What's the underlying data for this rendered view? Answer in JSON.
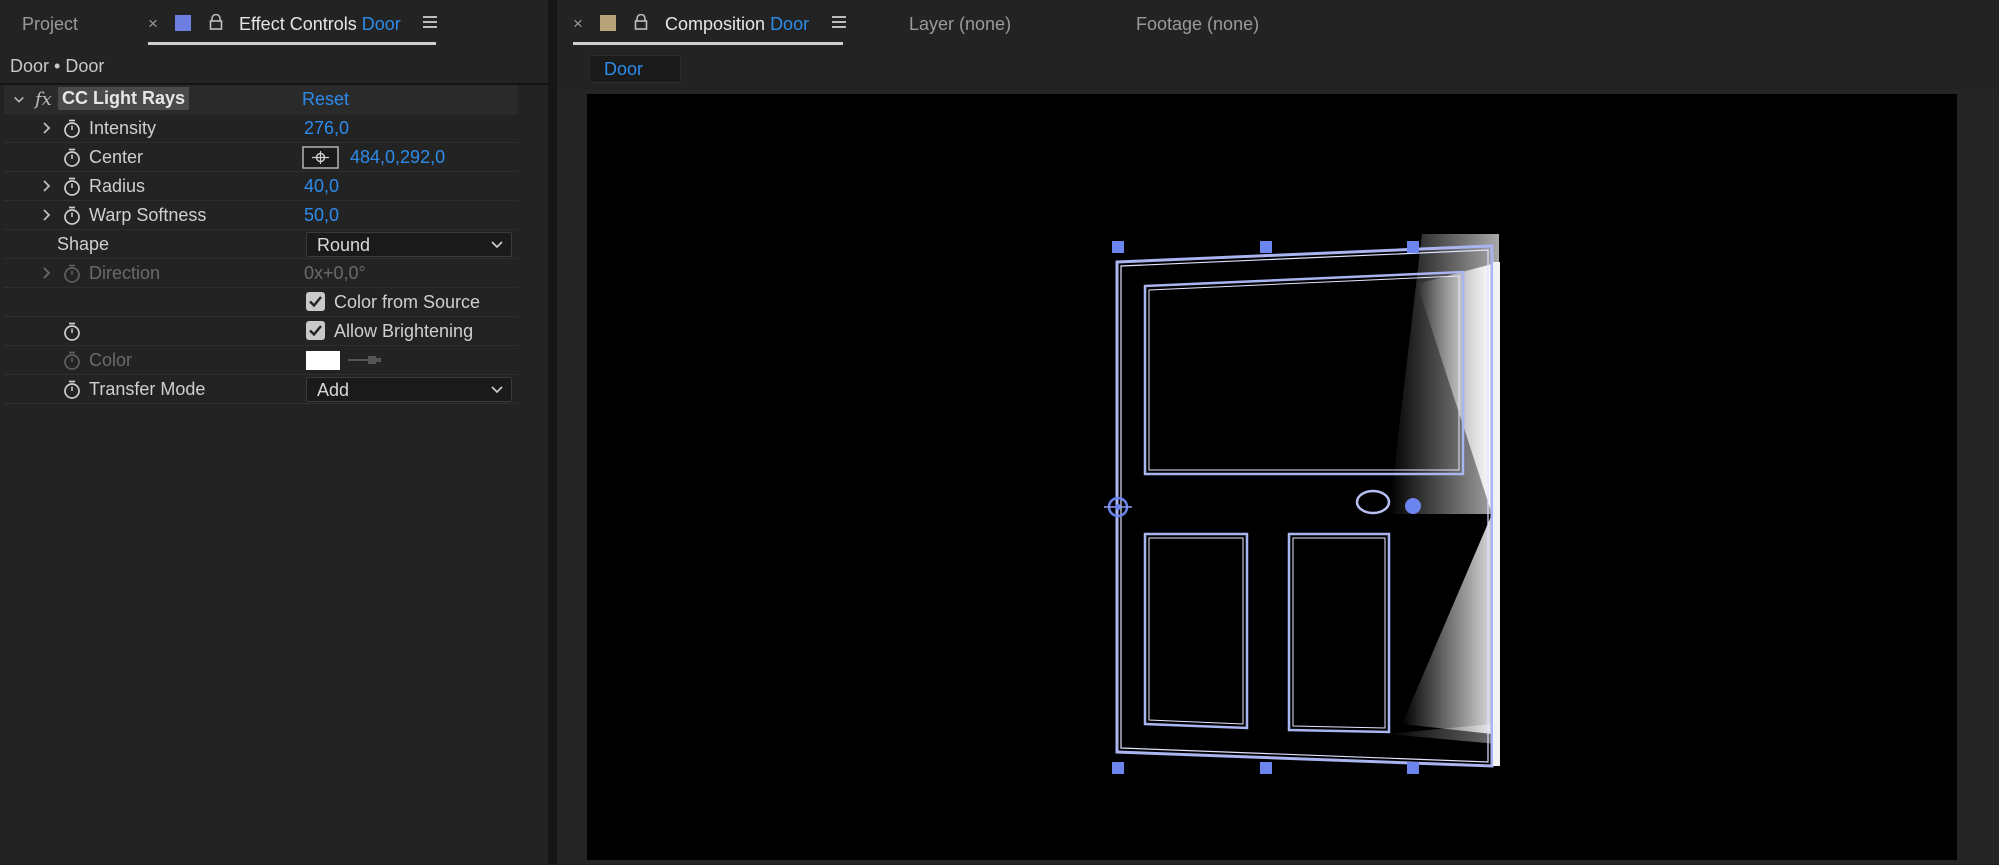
{
  "left_panel": {
    "tabs": {
      "project": "Project",
      "effect_controls_title": "Effect Controls",
      "effect_controls_layer": "Door",
      "close_symbol": "×"
    },
    "breadcrumb": "Door • Door",
    "effect": {
      "fx_label": "fx",
      "name": "CC Light Rays",
      "reset": "Reset"
    },
    "properties": {
      "intensity": {
        "label": "Intensity",
        "value": "276,0"
      },
      "center": {
        "label": "Center",
        "value": "484,0,292,0"
      },
      "radius": {
        "label": "Radius",
        "value": "40,0"
      },
      "warp_softness": {
        "label": "Warp Softness",
        "value": "50,0"
      },
      "shape": {
        "label": "Shape",
        "value": "Round"
      },
      "direction": {
        "label": "Direction",
        "value": "0x+0,0°"
      },
      "color_from_source": {
        "label": "Color from Source",
        "checked": true
      },
      "allow_brightening": {
        "label": "Allow Brightening",
        "checked": true
      },
      "color": {
        "label": "Color",
        "swatch": "#ffffff"
      },
      "transfer_mode": {
        "label": "Transfer Mode",
        "value": "Add"
      }
    }
  },
  "right_panel": {
    "tabs": {
      "composition_title": "Composition",
      "composition_name": "Door",
      "layer": "Layer (none)",
      "footage": "Footage (none)",
      "close_symbol": "×"
    },
    "comp_subtab": "Door"
  },
  "colors": {
    "accent": "#2d8ceb",
    "layer_label": "#6c7fe0",
    "comp_label": "#b8a27a",
    "door_outline": "#aab4f0",
    "handle": "#6c84ee"
  },
  "icons": [
    "close-icon",
    "lock-icon",
    "panel-menu-icon",
    "stopwatch-icon",
    "chevron-right-icon",
    "chevron-down-icon",
    "position-target-icon",
    "eyedropper-icon",
    "checkbox-checked-icon"
  ]
}
